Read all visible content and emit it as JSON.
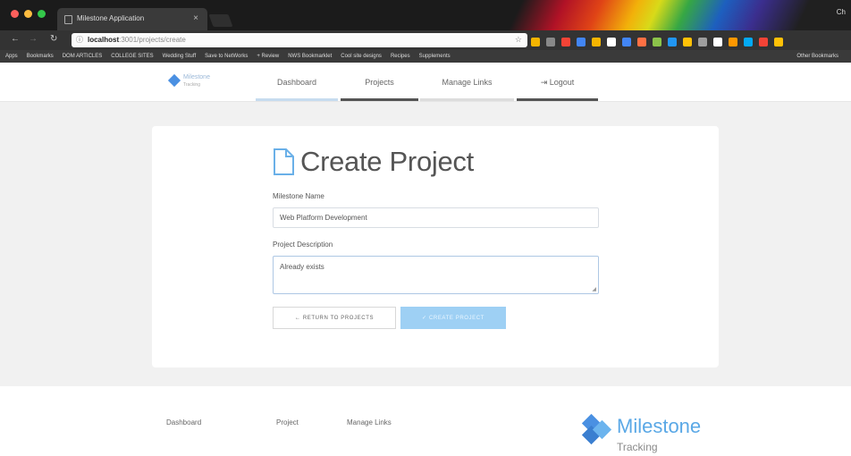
{
  "browser": {
    "tab_title": "Milestone Application",
    "url_host": "localhost",
    "url_path": ":3001/projects/create",
    "bookmarks": [
      "Apps",
      "Bookmarks",
      "DOM ARTICLES",
      "COLLEGE SITES",
      "Wedding Stuff",
      "Save to NetWorks",
      "+ Review",
      "NWS Bookmarklet",
      "Cool site designs",
      "Recipes",
      "Supplements"
    ],
    "other_bookmarks": "Other Bookmarks",
    "profile": "Ch",
    "extension_colors": [
      "#f4b400",
      "#888888",
      "#f44336",
      "#4285f4",
      "#f4b400",
      "#ffffff",
      "#4285f4",
      "#ff7043",
      "#8bc34a",
      "#2196f3",
      "#ffc107",
      "#9e9e9e",
      "#ffffff",
      "#ff9800",
      "#03a9f4",
      "#f44336",
      "#ffc107"
    ]
  },
  "nav": {
    "brand_line1": "Milestone",
    "brand_line2": "Tracking",
    "links": [
      {
        "label": "Dashboard",
        "bar": "#c7dcef"
      },
      {
        "label": "Projects",
        "bar": "#555555"
      },
      {
        "label": "Manage Links",
        "bar": "#dddddd"
      },
      {
        "label": "Logout",
        "bar": "#555555"
      }
    ],
    "logout_icon": "logout-icon"
  },
  "form": {
    "title": "Create Project",
    "title_icon": "document-icon",
    "name_label": "Milestone Name",
    "name_value": "Web Platform Development",
    "desc_label": "Project Description",
    "desc_value": "Already exists",
    "return_button": "RETURN TO PROJECTS",
    "create_button": "CREATE PROJECT"
  },
  "footer": {
    "links": [
      "Dashboard",
      "Project",
      "Manage Links"
    ],
    "logo_big": "Milestone",
    "logo_small": "Tracking"
  }
}
